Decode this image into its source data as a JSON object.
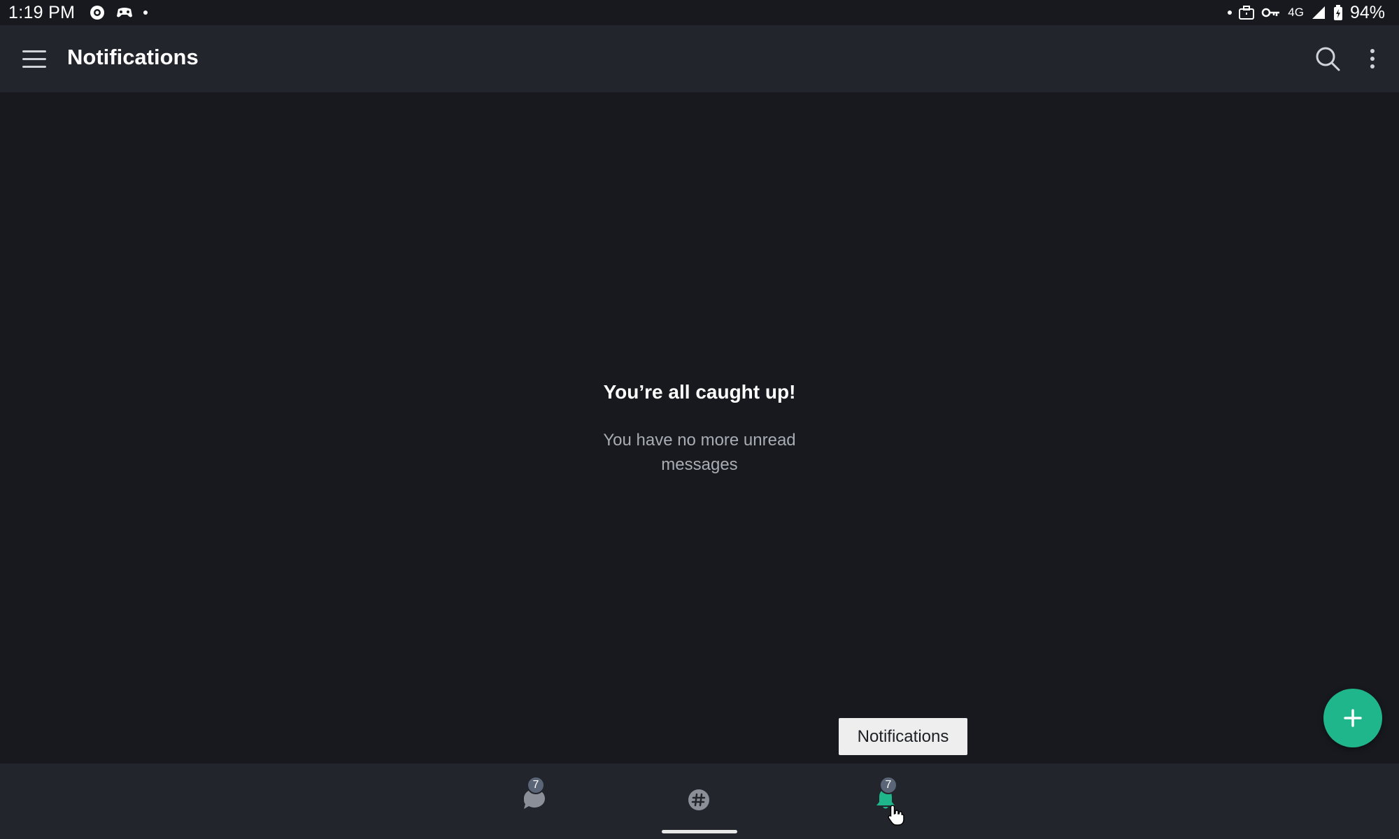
{
  "status_bar": {
    "time": "1:19 PM",
    "network": "4G",
    "battery": "94%"
  },
  "app_bar": {
    "title": "Notifications"
  },
  "empty_state": {
    "title": "You’re all caught up!",
    "subtitle": "You have no more unread messages"
  },
  "tooltip": {
    "text": "Notifications"
  },
  "bottom_nav": {
    "items": [
      {
        "name": "messages",
        "badge": "7",
        "active": false
      },
      {
        "name": "channels",
        "badge": "",
        "active": false
      },
      {
        "name": "notifications",
        "badge": "7",
        "active": true
      }
    ]
  },
  "colors": {
    "background": "#17191e",
    "bar": "#22252c",
    "accent": "#1fb68c",
    "badge": "#5a6577",
    "muted_text": "#a8acb3",
    "icon_inactive": "#8a8f98"
  },
  "icons": {
    "menu": "menu-icon",
    "search": "search-icon",
    "more": "more-vert-icon",
    "fab": "plus-icon",
    "messages": "chat-bubble-icon",
    "channels": "hashtag-icon",
    "notifications": "bell-icon"
  }
}
